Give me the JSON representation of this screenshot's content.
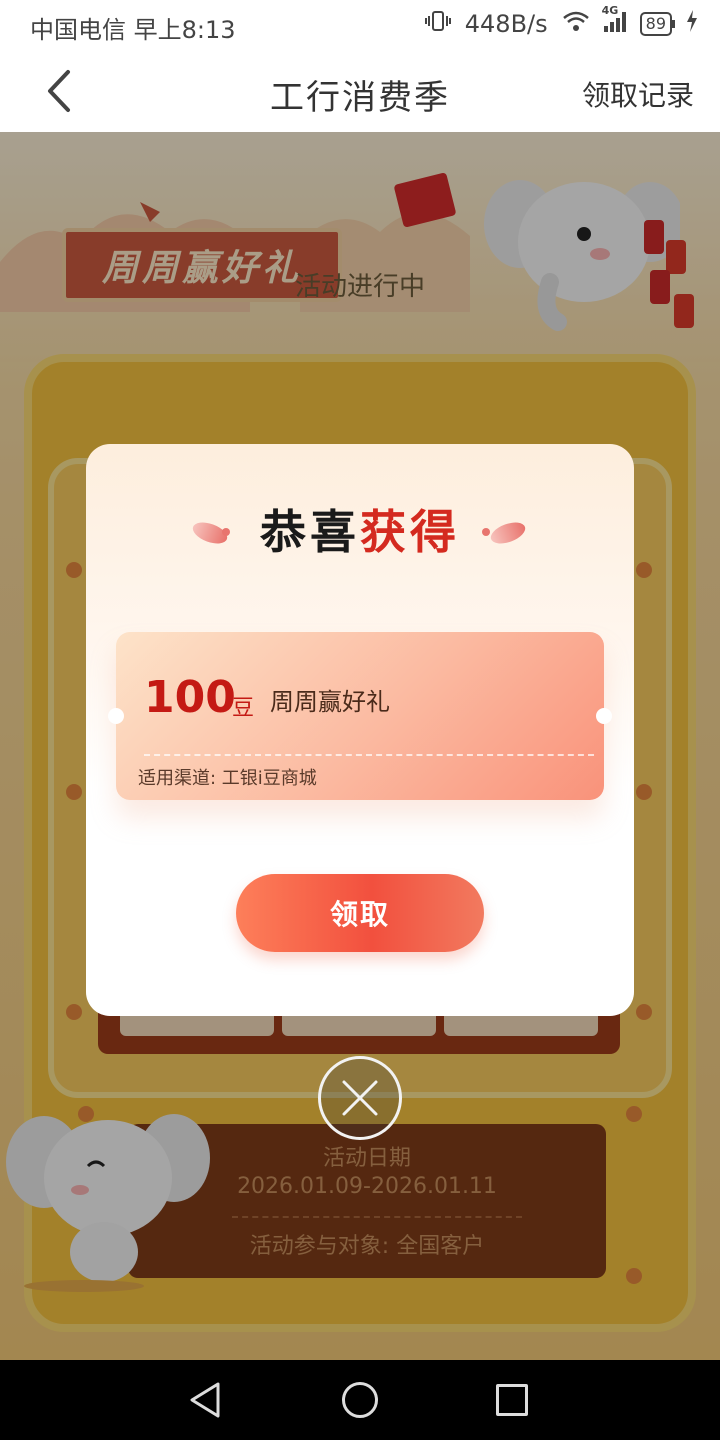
{
  "status_bar": {
    "carrier_time": "中国电信 早上8:13",
    "net_speed": "448B/s",
    "network": "4G",
    "battery": "89"
  },
  "nav": {
    "title": "工行消费季",
    "records_label": "领取记录"
  },
  "page": {
    "banner_label": "周周赢好礼",
    "activity_status": "活动进行中",
    "info": {
      "date_label": "活动日期",
      "date_range": "2026.01.09-2026.01.11",
      "target": "活动参与对象:   全国客户"
    }
  },
  "dialog": {
    "title_black": "恭喜",
    "title_red": "获得",
    "coupon": {
      "amount": "100",
      "unit": "豆",
      "name": "周周赢好礼",
      "channel": "适用渠道:  工银i豆商城"
    },
    "claim_label": "领取"
  }
}
